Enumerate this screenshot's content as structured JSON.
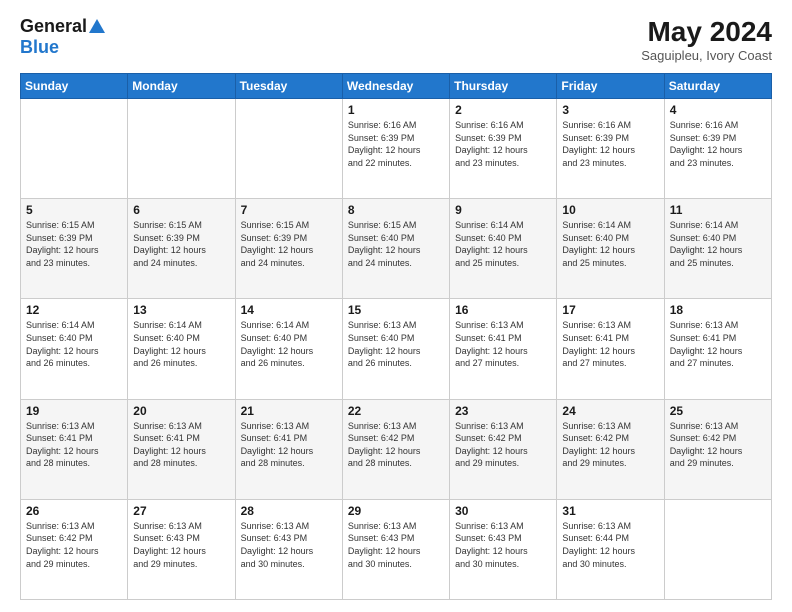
{
  "header": {
    "logo_general": "General",
    "logo_blue": "Blue",
    "title": "May 2024",
    "subtitle": "Saguipleu, Ivory Coast"
  },
  "weekdays": [
    "Sunday",
    "Monday",
    "Tuesday",
    "Wednesday",
    "Thursday",
    "Friday",
    "Saturday"
  ],
  "weeks": [
    [
      {
        "day": "",
        "info": ""
      },
      {
        "day": "",
        "info": ""
      },
      {
        "day": "",
        "info": ""
      },
      {
        "day": "1",
        "info": "Sunrise: 6:16 AM\nSunset: 6:39 PM\nDaylight: 12 hours\nand 22 minutes."
      },
      {
        "day": "2",
        "info": "Sunrise: 6:16 AM\nSunset: 6:39 PM\nDaylight: 12 hours\nand 23 minutes."
      },
      {
        "day": "3",
        "info": "Sunrise: 6:16 AM\nSunset: 6:39 PM\nDaylight: 12 hours\nand 23 minutes."
      },
      {
        "day": "4",
        "info": "Sunrise: 6:16 AM\nSunset: 6:39 PM\nDaylight: 12 hours\nand 23 minutes."
      }
    ],
    [
      {
        "day": "5",
        "info": "Sunrise: 6:15 AM\nSunset: 6:39 PM\nDaylight: 12 hours\nand 23 minutes."
      },
      {
        "day": "6",
        "info": "Sunrise: 6:15 AM\nSunset: 6:39 PM\nDaylight: 12 hours\nand 24 minutes."
      },
      {
        "day": "7",
        "info": "Sunrise: 6:15 AM\nSunset: 6:39 PM\nDaylight: 12 hours\nand 24 minutes."
      },
      {
        "day": "8",
        "info": "Sunrise: 6:15 AM\nSunset: 6:40 PM\nDaylight: 12 hours\nand 24 minutes."
      },
      {
        "day": "9",
        "info": "Sunrise: 6:14 AM\nSunset: 6:40 PM\nDaylight: 12 hours\nand 25 minutes."
      },
      {
        "day": "10",
        "info": "Sunrise: 6:14 AM\nSunset: 6:40 PM\nDaylight: 12 hours\nand 25 minutes."
      },
      {
        "day": "11",
        "info": "Sunrise: 6:14 AM\nSunset: 6:40 PM\nDaylight: 12 hours\nand 25 minutes."
      }
    ],
    [
      {
        "day": "12",
        "info": "Sunrise: 6:14 AM\nSunset: 6:40 PM\nDaylight: 12 hours\nand 26 minutes."
      },
      {
        "day": "13",
        "info": "Sunrise: 6:14 AM\nSunset: 6:40 PM\nDaylight: 12 hours\nand 26 minutes."
      },
      {
        "day": "14",
        "info": "Sunrise: 6:14 AM\nSunset: 6:40 PM\nDaylight: 12 hours\nand 26 minutes."
      },
      {
        "day": "15",
        "info": "Sunrise: 6:13 AM\nSunset: 6:40 PM\nDaylight: 12 hours\nand 26 minutes."
      },
      {
        "day": "16",
        "info": "Sunrise: 6:13 AM\nSunset: 6:41 PM\nDaylight: 12 hours\nand 27 minutes."
      },
      {
        "day": "17",
        "info": "Sunrise: 6:13 AM\nSunset: 6:41 PM\nDaylight: 12 hours\nand 27 minutes."
      },
      {
        "day": "18",
        "info": "Sunrise: 6:13 AM\nSunset: 6:41 PM\nDaylight: 12 hours\nand 27 minutes."
      }
    ],
    [
      {
        "day": "19",
        "info": "Sunrise: 6:13 AM\nSunset: 6:41 PM\nDaylight: 12 hours\nand 28 minutes."
      },
      {
        "day": "20",
        "info": "Sunrise: 6:13 AM\nSunset: 6:41 PM\nDaylight: 12 hours\nand 28 minutes."
      },
      {
        "day": "21",
        "info": "Sunrise: 6:13 AM\nSunset: 6:41 PM\nDaylight: 12 hours\nand 28 minutes."
      },
      {
        "day": "22",
        "info": "Sunrise: 6:13 AM\nSunset: 6:42 PM\nDaylight: 12 hours\nand 28 minutes."
      },
      {
        "day": "23",
        "info": "Sunrise: 6:13 AM\nSunset: 6:42 PM\nDaylight: 12 hours\nand 29 minutes."
      },
      {
        "day": "24",
        "info": "Sunrise: 6:13 AM\nSunset: 6:42 PM\nDaylight: 12 hours\nand 29 minutes."
      },
      {
        "day": "25",
        "info": "Sunrise: 6:13 AM\nSunset: 6:42 PM\nDaylight: 12 hours\nand 29 minutes."
      }
    ],
    [
      {
        "day": "26",
        "info": "Sunrise: 6:13 AM\nSunset: 6:42 PM\nDaylight: 12 hours\nand 29 minutes."
      },
      {
        "day": "27",
        "info": "Sunrise: 6:13 AM\nSunset: 6:43 PM\nDaylight: 12 hours\nand 29 minutes."
      },
      {
        "day": "28",
        "info": "Sunrise: 6:13 AM\nSunset: 6:43 PM\nDaylight: 12 hours\nand 30 minutes."
      },
      {
        "day": "29",
        "info": "Sunrise: 6:13 AM\nSunset: 6:43 PM\nDaylight: 12 hours\nand 30 minutes."
      },
      {
        "day": "30",
        "info": "Sunrise: 6:13 AM\nSunset: 6:43 PM\nDaylight: 12 hours\nand 30 minutes."
      },
      {
        "day": "31",
        "info": "Sunrise: 6:13 AM\nSunset: 6:44 PM\nDaylight: 12 hours\nand 30 minutes."
      },
      {
        "day": "",
        "info": ""
      }
    ]
  ]
}
